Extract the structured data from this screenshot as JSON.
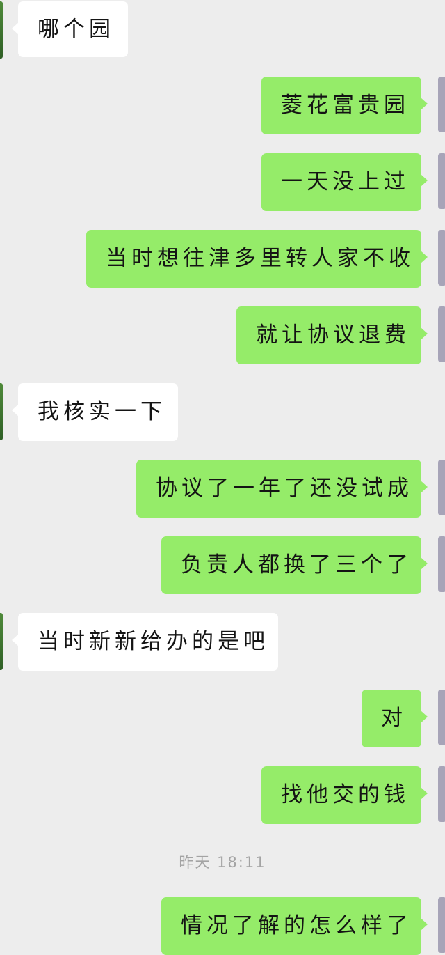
{
  "messages": [
    {
      "side": "in",
      "text": "哪个园"
    },
    {
      "side": "out",
      "text": "菱花富贵园"
    },
    {
      "side": "out",
      "text": "一天没上过"
    },
    {
      "side": "out",
      "text": "当时想往津多里转人家不收"
    },
    {
      "side": "out",
      "text": "就让协议退费"
    },
    {
      "side": "in",
      "text": "我核实一下"
    },
    {
      "side": "out",
      "text": "协议了一年了还没试成"
    },
    {
      "side": "out",
      "text": "负责人都换了三个了"
    },
    {
      "side": "in",
      "text": "当时新新给办的是吧"
    },
    {
      "side": "out",
      "text": "对"
    },
    {
      "side": "out",
      "text": "找他交的钱"
    },
    {
      "side": "out",
      "text": "情况了解的怎么样了"
    }
  ],
  "timestamp": "昨天 18:11",
  "colors": {
    "background": "#ededed",
    "incoming_bubble": "#ffffff",
    "outgoing_bubble": "#95ec69",
    "timestamp_text": "#a3a3a3"
  },
  "icons": [
    "contact-avatar",
    "user-avatar"
  ]
}
